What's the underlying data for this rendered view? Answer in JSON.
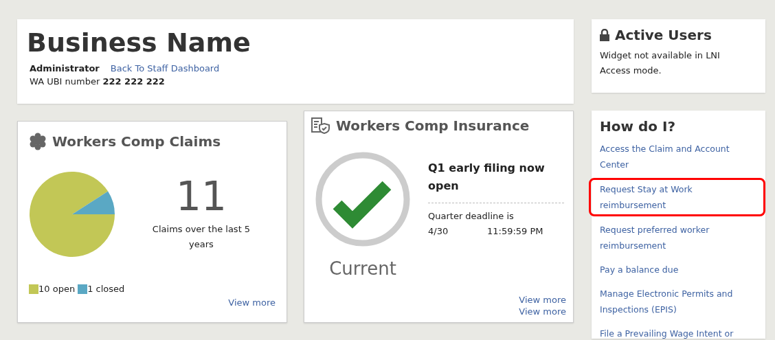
{
  "header": {
    "title": "Business Name",
    "role": "Administrator",
    "back_link": "Back To Staff Dashboard",
    "ubi_label": "WA UBI number",
    "ubi_number": "222 222 222"
  },
  "claims": {
    "title": "Workers Comp Claims",
    "count": "11",
    "caption": "Claims over the last 5 years",
    "chart_data": {
      "type": "pie",
      "categories": [
        "10 open",
        "1 closed"
      ],
      "values": [
        10,
        1
      ]
    },
    "legend": [
      {
        "color": "#c2c756"
      },
      {
        "color": "#5aa8c4"
      }
    ],
    "view_more": "View more"
  },
  "insurance": {
    "title": "Workers Comp Insurance",
    "status": "Current",
    "notice": "Q1 early filing now open",
    "deadline_label": "Quarter deadline is",
    "deadline_date": "4/30",
    "deadline_time": "11:59:59 PM",
    "links": [
      "View more",
      "View more"
    ]
  },
  "active_users": {
    "title": "Active Users",
    "message": "Widget not available in LNI Access mode."
  },
  "how_do_i": {
    "title": "How do I?",
    "links": [
      {
        "label": "Access the Claim and Account Center",
        "highlighted": false
      },
      {
        "label": "Request Stay at Work reimbursement",
        "highlighted": true
      },
      {
        "label": "Request preferred worker reimbursement",
        "highlighted": false
      },
      {
        "label": "Pay a balance due",
        "highlighted": false
      },
      {
        "label": "Manage Electronic Permits and Inspections (EPIS)",
        "highlighted": false
      },
      {
        "label": "File a Prevailing Wage Intent or",
        "highlighted": false
      }
    ]
  }
}
